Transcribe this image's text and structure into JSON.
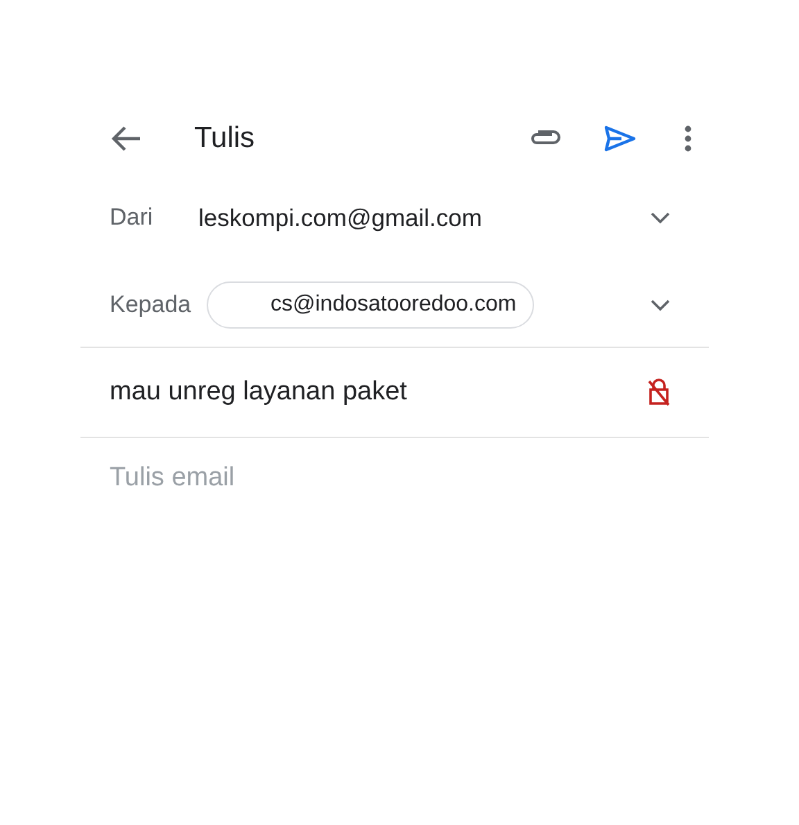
{
  "toolbar": {
    "title": "Tulis"
  },
  "from": {
    "label": "Dari",
    "value": "leskompi.com@gmail.com"
  },
  "to": {
    "label": "Kepada",
    "recipients": [
      "cs@indosatooredoo.com"
    ]
  },
  "subject": {
    "value": "mau unreg layanan paket"
  },
  "body": {
    "placeholder": "Tulis email"
  }
}
